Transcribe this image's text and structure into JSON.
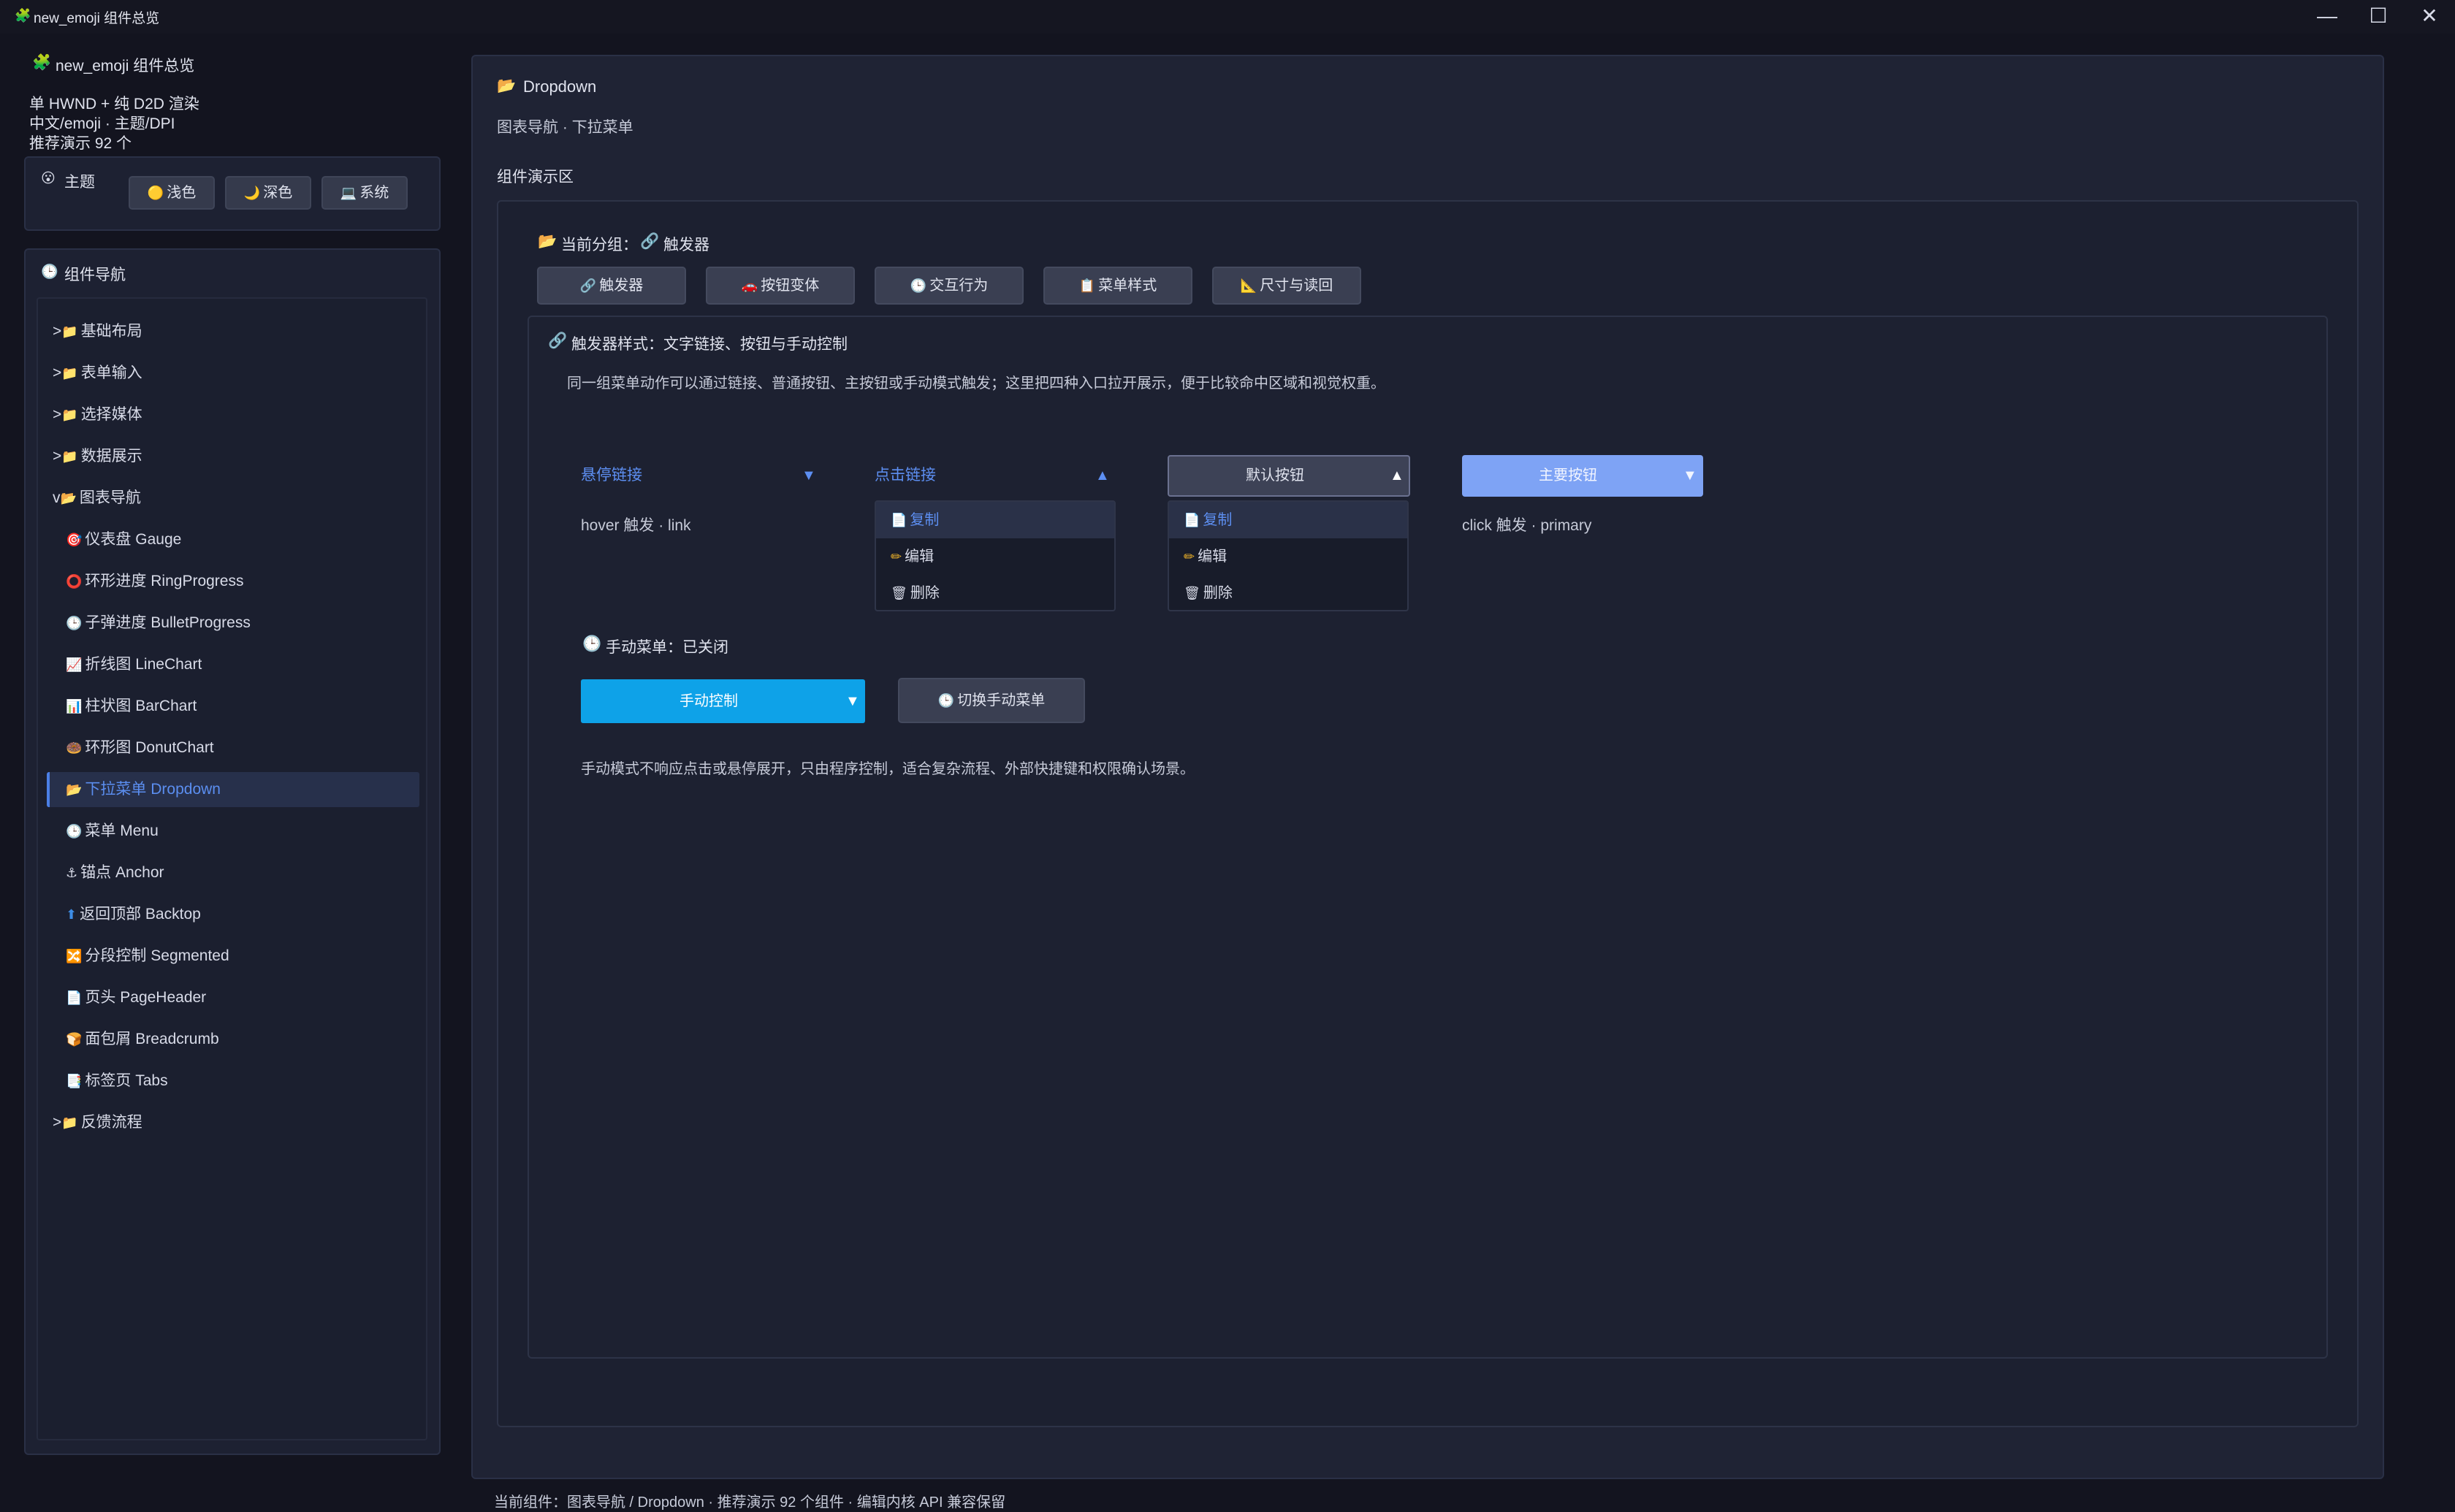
{
  "window": {
    "title": "new_emoji 组件总览",
    "logo_icon": "🧩",
    "min_symbol": "—",
    "max_symbol": "☐",
    "close_symbol": "✕"
  },
  "sidebar": {
    "app_title": "new_emoji 组件总览",
    "app_icon": "🧩",
    "info_lines": [
      "单 HWND + 纯 D2D 渲染",
      "中文/emoji · 主题/DPI",
      "推荐演示 92 个"
    ],
    "theme": {
      "label": "主题",
      "icon": "😮",
      "buttons": [
        {
          "icon": "🟡",
          "label": "浅色"
        },
        {
          "icon": "🌙",
          "label": "深色"
        },
        {
          "icon": "💻",
          "label": "系统"
        }
      ]
    },
    "nav": {
      "label": "组件导航",
      "icon": "🕒",
      "items": [
        {
          "prefix": ">",
          "icon": "📁",
          "label": "基础布局"
        },
        {
          "prefix": ">",
          "icon": "📁",
          "label": "表单输入"
        },
        {
          "prefix": ">",
          "icon": "📁",
          "label": "选择媒体"
        },
        {
          "prefix": ">",
          "icon": "📁",
          "label": "数据展示"
        },
        {
          "prefix": "v",
          "icon": "📂",
          "label": "图表导航"
        },
        {
          "prefix": "",
          "icon": "🎯",
          "label": "仪表盘 Gauge"
        },
        {
          "prefix": "",
          "icon": "⭕",
          "label": "环形进度 RingProgress"
        },
        {
          "prefix": "",
          "icon": "🕒",
          "label": "子弹进度 BulletProgress"
        },
        {
          "prefix": "",
          "icon": "📈",
          "label": "折线图 LineChart"
        },
        {
          "prefix": "",
          "icon": "📊",
          "label": "柱状图 BarChart"
        },
        {
          "prefix": "",
          "icon": "🍩",
          "label": "环形图 DonutChart"
        },
        {
          "prefix": "",
          "icon": "📂",
          "label": "下拉菜单 Dropdown"
        },
        {
          "prefix": "",
          "icon": "🕒",
          "label": "菜单 Menu"
        },
        {
          "prefix": "",
          "icon": "⚓",
          "label": "锚点 Anchor"
        },
        {
          "prefix": "",
          "icon": "⬆",
          "label": "返回顶部 Backtop"
        },
        {
          "prefix": "",
          "icon": "🔀",
          "label": "分段控制 Segmented"
        },
        {
          "prefix": "",
          "icon": "📄",
          "label": "页头 PageHeader"
        },
        {
          "prefix": "",
          "icon": "🍞",
          "label": "面包屑 Breadcrumb"
        },
        {
          "prefix": "",
          "icon": "📑",
          "label": "标签页 Tabs"
        },
        {
          "prefix": ">",
          "icon": "📁",
          "label": "反馈流程"
        }
      ]
    }
  },
  "main": {
    "title": "Dropdown",
    "title_icon": "📂",
    "subtitle": "图表导航 · 下拉菜单",
    "section_label": "组件演示区",
    "current_group": {
      "icon": "📂",
      "label": "当前分组：",
      "value_icon": "🔗",
      "value": "触发器"
    },
    "group_buttons": [
      {
        "icon": "🔗",
        "label": "触发器"
      },
      {
        "icon": "🚗",
        "label": "按钮变体"
      },
      {
        "icon": "🕒",
        "label": "交互行为"
      },
      {
        "icon": "📋",
        "label": "菜单样式"
      },
      {
        "icon": "📐",
        "label": "尺寸与读回"
      }
    ],
    "trigger_section": {
      "icon": "🔗",
      "title": "触发器样式：文字链接、按钮与手动控制",
      "description": "同一组菜单动作可以通过链接、普通按钮、主按钮或手动模式触发；这里把四种入口拉开展示，便于比较命中区域和视觉权重。"
    },
    "dropdowns": {
      "hover_link": {
        "label": "悬停链接",
        "caret": "▼",
        "caption": "hover 触发 · link"
      },
      "click_link": {
        "label": "点击链接",
        "caret": "▲"
      },
      "default_button": {
        "label": "默认按钮",
        "caret": "▲"
      },
      "primary_button": {
        "label": "主要按钮",
        "caret": "▼",
        "caption": "click 触发 · primary"
      }
    },
    "menu_items": [
      {
        "icon": "📄",
        "label": "复制"
      },
      {
        "icon": "✏",
        "label": "编辑"
      },
      {
        "icon": "🗑",
        "label": "删除"
      }
    ],
    "manual": {
      "status_icon": "🕒",
      "status": "手动菜单：已关闭",
      "control_label": "手动控制",
      "control_caret": "▼",
      "toggle_icon": "🕒",
      "toggle_label": "切换手动菜单",
      "note": "手动模式不响应点击或悬停展开，只由程序控制，适合复杂流程、外部快捷键和权限确认场景。"
    }
  },
  "statusbar": {
    "text": "当前组件：图表导航 / Dropdown · 推荐演示 92 个组件 · 编辑内核 API 兼容保留"
  },
  "colors": {
    "background": "#13141f",
    "panel": "#1d2132",
    "accent": "#5d8ff2",
    "primary_button": "#7ea3f5",
    "manual_button": "#0ea2e8"
  }
}
